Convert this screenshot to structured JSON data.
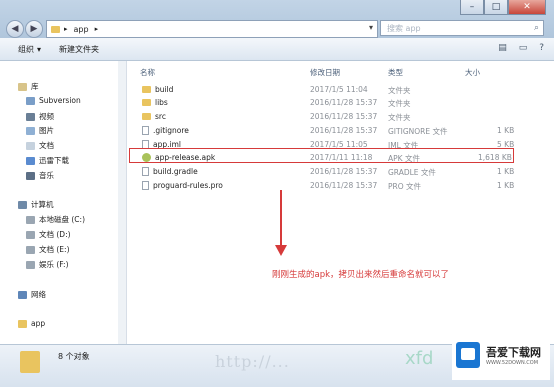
{
  "address": {
    "crumb": "app"
  },
  "search": {
    "placeholder": "搜索 app"
  },
  "toolbar": {
    "organize": "组织",
    "new_folder": "新建文件夹"
  },
  "sidebar": {
    "library": "库",
    "libs": [
      "Subversion",
      "视频",
      "图片",
      "文档",
      "迅雷下载",
      "音乐"
    ],
    "computer": "计算机",
    "drives": [
      "本地磁盘 (C:)",
      "文档 (D:)",
      "文档 (E:)",
      "娱乐 (F:)"
    ],
    "network": "网络",
    "current": "app"
  },
  "columns": {
    "name": "名称",
    "date": "修改日期",
    "type": "类型",
    "size": "大小"
  },
  "files": [
    {
      "name": "build",
      "date": "2017/1/5 11:04",
      "type": "文件夹",
      "size": "",
      "icon": "folder"
    },
    {
      "name": "libs",
      "date": "2016/11/28 15:37",
      "type": "文件夹",
      "size": "",
      "icon": "folder"
    },
    {
      "name": "src",
      "date": "2016/11/28 15:37",
      "type": "文件夹",
      "size": "",
      "icon": "folder"
    },
    {
      "name": ".gitignore",
      "date": "2016/11/28 15:37",
      "type": "GITIGNORE 文件",
      "size": "1 KB",
      "icon": "file"
    },
    {
      "name": "app.iml",
      "date": "2017/1/5 11:05",
      "type": "IML 文件",
      "size": "5 KB",
      "icon": "file"
    },
    {
      "name": "app-release.apk",
      "date": "2017/1/11 11:18",
      "type": "APK 文件",
      "size": "1,618 KB",
      "icon": "apk"
    },
    {
      "name": "build.gradle",
      "date": "2016/11/28 15:37",
      "type": "GRADLE 文件",
      "size": "1 KB",
      "icon": "file"
    },
    {
      "name": "proguard-rules.pro",
      "date": "2016/11/28 15:37",
      "type": "PRO 文件",
      "size": "1 KB",
      "icon": "file"
    }
  ],
  "annotation": "刚刚生成的apk，拷贝出来然后重命名就可以了",
  "status": {
    "count": "8 个对象"
  },
  "watermark": {
    "url": "http://...",
    "brand": "xfd"
  },
  "logo": {
    "title": "吾爱下载网",
    "sub": "WWW.52DOWN.COM"
  },
  "colors": {
    "highlight": "#d63a3a",
    "folder": "#e9c45f"
  }
}
